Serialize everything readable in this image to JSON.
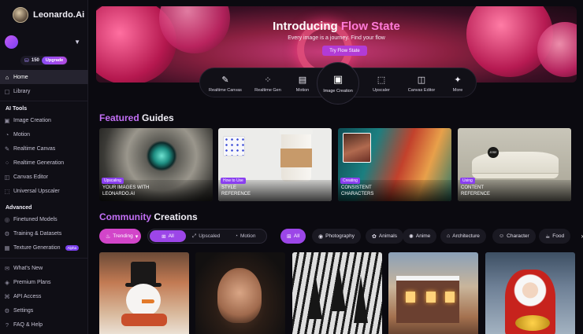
{
  "brand": {
    "name": "Leonardo.Ai"
  },
  "account": {
    "tokens": "150",
    "upgrade_label": "Upgrade"
  },
  "nav_top": [
    {
      "label": "Home",
      "icon": "home-icon"
    },
    {
      "label": "Library",
      "icon": "library-icon"
    }
  ],
  "ai_tools": {
    "title": "AI Tools",
    "items": [
      {
        "label": "Image Creation",
        "icon": "image-icon"
      },
      {
        "label": "Motion",
        "icon": "motion-icon"
      },
      {
        "label": "Realtime Canvas",
        "icon": "canvas-icon"
      },
      {
        "label": "Realtime Generation",
        "icon": "realtime-icon"
      },
      {
        "label": "Canvas Editor",
        "icon": "editor-icon"
      },
      {
        "label": "Universal Upscaler",
        "icon": "upscaler-icon"
      }
    ]
  },
  "advanced": {
    "title": "Advanced",
    "items": [
      {
        "label": "Finetuned Models",
        "icon": "models-icon"
      },
      {
        "label": "Training & Datasets",
        "icon": "training-icon"
      },
      {
        "label": "Texture Generation",
        "icon": "texture-icon",
        "badge": "Alpha"
      }
    ]
  },
  "nav_bottom": [
    {
      "label": "What's New",
      "icon": "megaphone-icon"
    },
    {
      "label": "Premium Plans",
      "icon": "premium-icon"
    },
    {
      "label": "API Access",
      "icon": "api-icon"
    },
    {
      "label": "Settings",
      "icon": "gear-icon"
    },
    {
      "label": "FAQ & Help",
      "icon": "help-icon"
    }
  ],
  "hero": {
    "title_prefix": "Introducing",
    "title_accent": "Flow State",
    "subtitle": "Every image is a journey. Find your flow",
    "button_label": "Try Flow State"
  },
  "tools": [
    {
      "label": "Realtime Canvas",
      "glyph": "✎"
    },
    {
      "label": "Realtime Gen",
      "glyph": "⁘"
    },
    {
      "label": "Motion",
      "glyph": "▤"
    },
    {
      "label": "Image Creation",
      "glyph": "▣"
    },
    {
      "label": "Upscaler",
      "glyph": "⬚"
    },
    {
      "label": "Canvas Editor",
      "glyph": "◫"
    },
    {
      "label": "More",
      "glyph": "✦"
    }
  ],
  "featured": {
    "title_accent": "Featured",
    "title_rest": "Guides",
    "guides": [
      {
        "tag": "Upscaling",
        "title_line1": "YOUR IMAGES WITH",
        "title_line2": "LEONARDO.AI"
      },
      {
        "tag": "How to Use",
        "title_line1": "STYLE",
        "title_line2": "REFERENCE"
      },
      {
        "tag": "Creating",
        "title_line1": "CONSISTENT",
        "title_line2": "CHARACTERS"
      },
      {
        "tag": "Using",
        "title_line1": "CONTENT",
        "title_line2": "REFERENCE"
      }
    ],
    "sneaker_label": "JOSE"
  },
  "community": {
    "title_accent": "Community",
    "title_rest": "Creations",
    "sort_label": "Trending",
    "segments": [
      "All",
      "Upscaled",
      "Motion"
    ],
    "categories": [
      "All",
      "Photography",
      "Animals",
      "Anime",
      "Architecture",
      "Character",
      "Food"
    ]
  }
}
